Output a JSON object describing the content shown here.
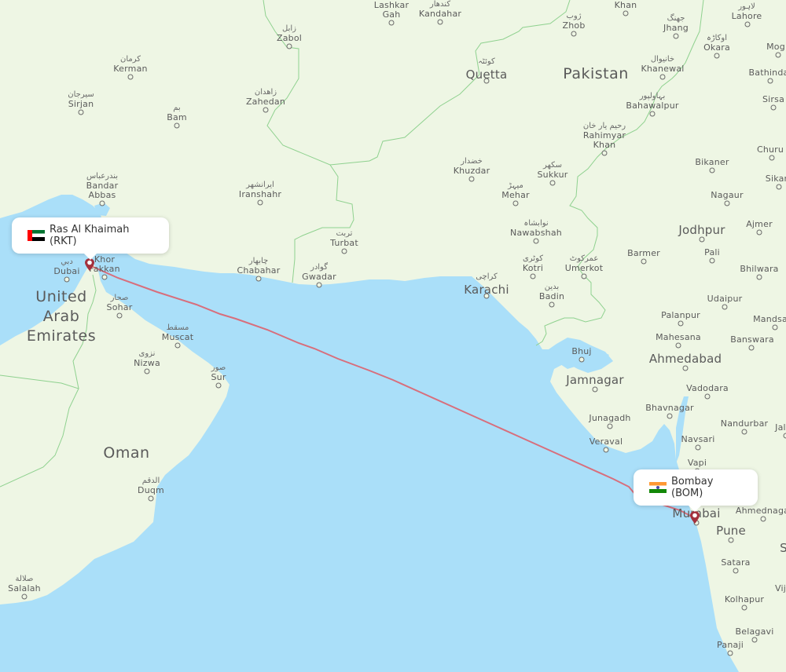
{
  "map": {
    "colors": {
      "water": "#aadff9",
      "land": "#eef6e4",
      "border": "#8fd18f",
      "route": "#e05a66",
      "marker": "#a3313d"
    },
    "origin": {
      "name": "Ras Al Khaimah (RKT)",
      "flag": "uae-flag"
    },
    "destination": {
      "name": "Bombay (BOM)",
      "flag": "india-flag"
    },
    "countries": {
      "pakistan": "Pakistan",
      "oman": "Oman",
      "uae_1": "United",
      "uae_2": "Arab",
      "uae_3": "Emirates"
    },
    "cities": {
      "lashkar_gah": {
        "name1": "Lashkar",
        "name2": "Gah"
      },
      "kandahar": {
        "name": "Kandahar",
        "ar": "کندهار"
      },
      "zhob": {
        "name": "Zhob",
        "ar": "ژوب"
      },
      "khan": {
        "name": "Khan"
      },
      "jhang": {
        "name": "Jhang",
        "ar": "جھنگ"
      },
      "lahore": {
        "name": "Lahore",
        "ar": "لاہور"
      },
      "okara": {
        "name": "Okara",
        "ar": "اوکاڑہ"
      },
      "moga": {
        "name": "Mog"
      },
      "zabol": {
        "name": "Zabol",
        "ar": "زابل"
      },
      "kerman": {
        "name": "Kerman",
        "ar": "کرمان"
      },
      "quetta": {
        "name": "Quetta",
        "ar": "کوئٹہ"
      },
      "khanewal": {
        "name": "Khanewal",
        "ar": "خانیوال"
      },
      "bathinda": {
        "name": "Bathinda"
      },
      "sirjan": {
        "name": "Sirjan",
        "ar": "سیرجان"
      },
      "zahedan": {
        "name": "Zahedan",
        "ar": "زاهدان"
      },
      "bam": {
        "name": "Bam",
        "ar": "بم"
      },
      "bahawalpur": {
        "name": "Bahawalpur",
        "ar": "بہاولپور"
      },
      "sirsa": {
        "name": "Sirsa"
      },
      "rahimyar_khan": {
        "name1": "Rahimyar",
        "name2": "Khan",
        "ar": "رحیم یار خان"
      },
      "churu": {
        "name": "Churu"
      },
      "bikaner": {
        "name": "Bikaner"
      },
      "khuzdar": {
        "name": "Khuzdar",
        "ar": "خضدار"
      },
      "sukkur": {
        "name": "Sukkur",
        "ar": "سکھر"
      },
      "sikar": {
        "name": "Sikar"
      },
      "bandar_abbas": {
        "name1": "Bandar",
        "name2": "Abbas",
        "ar": "بندرعباس"
      },
      "iranshahr": {
        "name": "Iranshahr",
        "ar": "ایرانشهر"
      },
      "mehar": {
        "name": "Mehar",
        "ar": "میہڑ"
      },
      "nagaur": {
        "name": "Nagaur"
      },
      "nawabshah": {
        "name": "Nawabshah",
        "ar": "نوابشاہ"
      },
      "ajmer": {
        "name": "Ajmer"
      },
      "turbat": {
        "name": "Turbat",
        "ar": "تربت"
      },
      "jodhpur": {
        "name": "Jodhpur"
      },
      "barmer": {
        "name": "Barmer"
      },
      "pali": {
        "name": "Pali"
      },
      "kotri": {
        "name": "Kotri",
        "ar": "کوٹری"
      },
      "umerkot": {
        "name": "Umerkot",
        "ar": "عمرکوٹ"
      },
      "bhilwara": {
        "name": "Bhilwara"
      },
      "dubai": {
        "name": "Dubai",
        "ar": "دبي"
      },
      "khor_fakkan": {
        "name1": "Khor",
        "name2": "Fakkan"
      },
      "chabahar": {
        "name": "Chabahar",
        "ar": "چابهار"
      },
      "gwadar": {
        "name": "Gwadar",
        "ar": "گوادر"
      },
      "karachi": {
        "name": "Karachi",
        "ar": "کراچی"
      },
      "badin": {
        "name": "Badin",
        "ar": "بدین"
      },
      "udaipur": {
        "name": "Udaipur"
      },
      "sohar": {
        "name": "Sohar",
        "ar": "صحار"
      },
      "palanpur": {
        "name": "Palanpur"
      },
      "mandsaur": {
        "name": "Mandsa"
      },
      "muscat": {
        "name": "Muscat",
        "ar": "مسقط"
      },
      "mahesana": {
        "name": "Mahesana"
      },
      "banswara": {
        "name": "Banswara"
      },
      "bhuj": {
        "name": "Bhuj"
      },
      "ahmedabad": {
        "name": "Ahmedabad"
      },
      "nizwa": {
        "name": "Nizwa",
        "ar": "نزوى"
      },
      "sur": {
        "name": "Sur",
        "ar": "صور"
      },
      "jamnagar": {
        "name": "Jamnagar"
      },
      "vadodara": {
        "name": "Vadodara"
      },
      "bhavnagar": {
        "name": "Bhavnagar"
      },
      "junagadh": {
        "name": "Junagadh"
      },
      "nandurbar": {
        "name": "Nandurbar"
      },
      "navsari": {
        "name": "Navsari"
      },
      "jalgaon": {
        "name": "Jal"
      },
      "veraval": {
        "name": "Veraval"
      },
      "vapi": {
        "name": "Vapi"
      },
      "duqm": {
        "name": "Duqm",
        "ar": "الدقم"
      },
      "mumbai": {
        "name": "Mumbai"
      },
      "ahmednagar": {
        "name": "Ahmednaga"
      },
      "pune": {
        "name": "Pune"
      },
      "satara": {
        "name": "Satara"
      },
      "s_label": {
        "name": "S"
      },
      "kolhapur": {
        "name": "Kolhapur"
      },
      "vijayapura": {
        "name": "Vij"
      },
      "salalah": {
        "name": "Salalah",
        "ar": "صلالة"
      },
      "belagavi": {
        "name": "Belagavi"
      },
      "panaji": {
        "name": "Panaji"
      }
    }
  }
}
